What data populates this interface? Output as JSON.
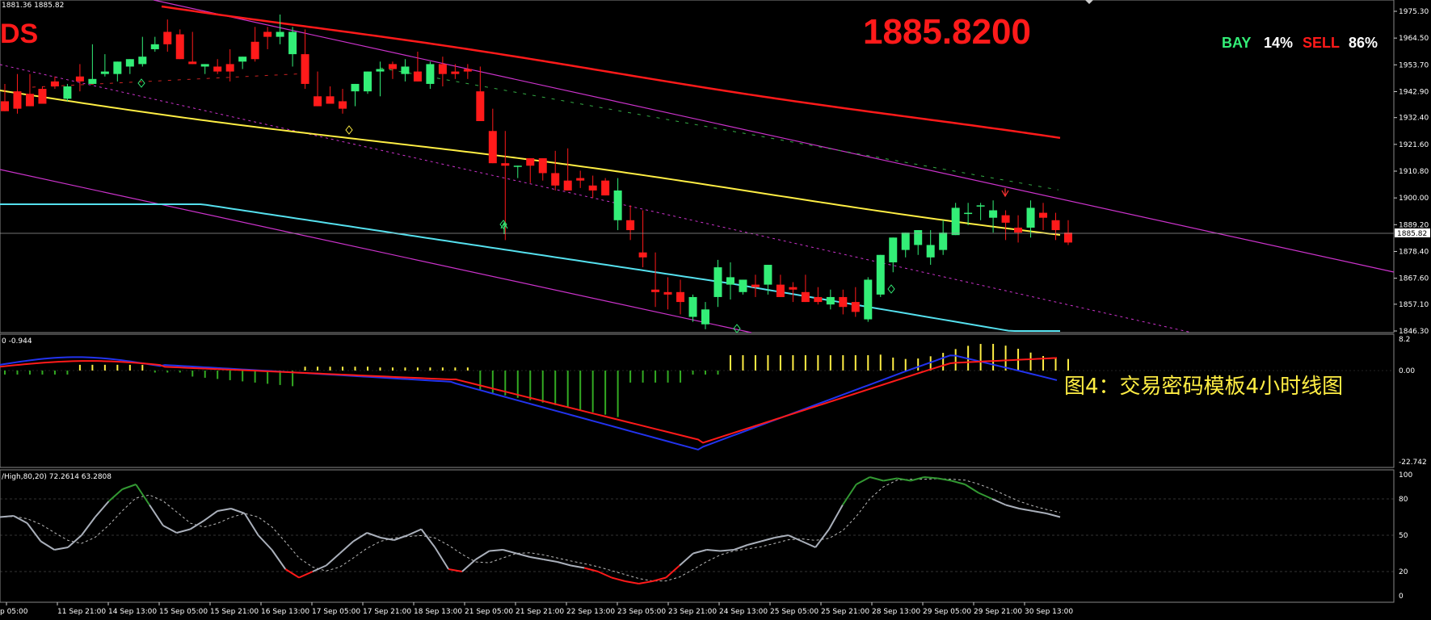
{
  "window": {
    "top_info": "1881.36 1885.82",
    "symbol_fragment": "DS",
    "big_price": "1885.8200",
    "bay_label": "BAY",
    "bay_pct": "14%",
    "sell_label": "SELL",
    "sell_pct": "86%",
    "caption": "图4：交易密码模板4小时线图",
    "current_price_tag": "1885.82"
  },
  "price_axis": [
    "1975.30",
    "1964.50",
    "1953.70",
    "1942.90",
    "1932.40",
    "1921.60",
    "1910.80",
    "1900.00",
    "1889.20",
    "1878.40",
    "1867.60",
    "1857.10",
    "1846.30"
  ],
  "macd": {
    "label": "0 -0.944",
    "axis": [
      "8.2",
      "0.00",
      "-22.742"
    ]
  },
  "stoch": {
    "label": "/High,80,20) 72.2614 63.2808",
    "axis": [
      "100",
      "80",
      "50",
      "20",
      "0"
    ]
  },
  "time_axis": [
    "p 05:00",
    "11 Sep 21:00",
    "14 Sep 13:00",
    "15 Sep 05:00",
    "15 Sep 21:00",
    "16 Sep 13:00",
    "17 Sep 05:00",
    "17 Sep 21:00",
    "18 Sep 13:00",
    "21 Sep 05:00",
    "21 Sep 21:00",
    "22 Sep 13:00",
    "23 Sep 05:00",
    "23 Sep 21:00",
    "24 Sep 13:00",
    "25 Sep 05:00",
    "25 Sep 21:00",
    "28 Sep 13:00",
    "29 Sep 05:00",
    "29 Sep 21:00",
    "30 Sep 13:00"
  ],
  "colors": {
    "bull": "#33ee77",
    "bear": "#ff1a1a",
    "ma_red": "#ff1a1a",
    "ma_yellow": "#ffee44",
    "ma_cyan": "#55e0ee",
    "channel": "#cc33cc",
    "macd_main": "#2233ee",
    "macd_signal": "#ff1a1a"
  },
  "chart_data": {
    "type": "candlestick",
    "candles": [
      [
        1939,
        1946,
        1936,
        1935
      ],
      [
        1943,
        1950,
        1934,
        1936
      ],
      [
        1942,
        1950,
        1938,
        1937
      ],
      [
        1944,
        1945,
        1940,
        1938
      ],
      [
        1947,
        1949,
        1944,
        1945
      ],
      [
        1940,
        1946,
        1939,
        1945
      ],
      [
        1949,
        1954,
        1943,
        1947
      ],
      [
        1946,
        1962,
        1946,
        1948
      ],
      [
        1950,
        1958,
        1949,
        1951
      ],
      [
        1950,
        1955,
        1947,
        1955
      ],
      [
        1953,
        1955,
        1950,
        1956
      ],
      [
        1954,
        1965,
        1953,
        1957
      ],
      [
        1960,
        1965,
        1959,
        1962
      ],
      [
        1967,
        1972,
        1959,
        1962
      ],
      [
        1966,
        1968,
        1964,
        1956
      ],
      [
        1955,
        1967,
        1954,
        1954
      ],
      [
        1953,
        1954,
        1950,
        1954
      ],
      [
        1953,
        1956,
        1950,
        1951
      ],
      [
        1954,
        1960,
        1947,
        1951
      ],
      [
        1955,
        1955,
        1952,
        1957
      ],
      [
        1963,
        1969,
        1955,
        1956
      ],
      [
        1967,
        1969,
        1960,
        1965
      ],
      [
        1965,
        1974,
        1962,
        1967
      ],
      [
        1958,
        1969,
        1953,
        1967
      ],
      [
        1958,
        1968,
        1944,
        1946
      ],
      [
        1941,
        1951,
        1939,
        1937
      ],
      [
        1941,
        1945,
        1938,
        1938
      ],
      [
        1939,
        1944,
        1934,
        1936
      ],
      [
        1943,
        1942,
        1937,
        1946
      ],
      [
        1943,
        1951,
        1942,
        1951
      ],
      [
        1951,
        1955,
        1941,
        1952
      ],
      [
        1954,
        1955,
        1948,
        1952
      ],
      [
        1950,
        1956,
        1947,
        1953
      ],
      [
        1951,
        1959,
        1948,
        1947
      ],
      [
        1946,
        1955,
        1944,
        1954
      ],
      [
        1954,
        1957,
        1945,
        1950
      ],
      [
        1951,
        1954,
        1948,
        1950
      ],
      [
        1952,
        1954,
        1948,
        1951
      ],
      [
        1943,
        1953,
        1936,
        1931
      ],
      [
        1927,
        1936,
        1915,
        1914
      ],
      [
        1914,
        1927,
        1883,
        1913
      ],
      [
        1913,
        1913,
        1908,
        1913
      ],
      [
        1916,
        1916,
        1906,
        1913
      ],
      [
        1916,
        1916,
        1907,
        1910
      ],
      [
        1910,
        1919,
        1903,
        1905
      ],
      [
        1907,
        1920,
        1906,
        1903
      ],
      [
        1908,
        1911,
        1904,
        1907
      ],
      [
        1905,
        1909,
        1900,
        1903
      ],
      [
        1907,
        1908,
        1903,
        1901
      ],
      [
        1891,
        1908,
        1887,
        1903
      ],
      [
        1891,
        1897,
        1883,
        1887
      ],
      [
        1878,
        1895,
        1872,
        1876
      ],
      [
        1863,
        1878,
        1856,
        1862
      ],
      [
        1862,
        1868,
        1855,
        1861
      ],
      [
        1862,
        1867,
        1853,
        1858
      ],
      [
        1852,
        1861,
        1850,
        1860
      ],
      [
        1849,
        1858,
        1847,
        1855
      ],
      [
        1860,
        1875,
        1856,
        1872
      ],
      [
        1865,
        1874,
        1859,
        1868
      ],
      [
        1862,
        1865,
        1861,
        1867
      ],
      [
        1865,
        1869,
        1860,
        1864
      ],
      [
        1865,
        1868,
        1861,
        1873
      ],
      [
        1865,
        1869,
        1862,
        1860
      ],
      [
        1864,
        1866,
        1858,
        1863
      ],
      [
        1862,
        1869,
        1860,
        1858
      ],
      [
        1860,
        1864,
        1857,
        1858
      ],
      [
        1857,
        1863,
        1855,
        1860
      ],
      [
        1860,
        1863,
        1853,
        1856
      ],
      [
        1858,
        1864,
        1852,
        1854
      ],
      [
        1851,
        1868,
        1850,
        1867
      ],
      [
        1861,
        1874,
        1860,
        1877
      ],
      [
        1874,
        1881,
        1870,
        1884
      ],
      [
        1879,
        1884,
        1876,
        1886
      ],
      [
        1881,
        1883,
        1877,
        1887
      ],
      [
        1876,
        1887,
        1873,
        1881
      ],
      [
        1879,
        1891,
        1877,
        1886
      ],
      [
        1885,
        1898,
        1885,
        1896
      ],
      [
        1894,
        1898,
        1889,
        1894
      ],
      [
        1897,
        1898,
        1891,
        1897
      ],
      [
        1892,
        1899,
        1886,
        1895
      ],
      [
        1893,
        1895,
        1883,
        1890
      ],
      [
        1888,
        1893,
        1882,
        1886
      ],
      [
        1888,
        1899,
        1884,
        1896
      ],
      [
        1894,
        1898,
        1887,
        1892
      ],
      [
        1891,
        1894,
        1883,
        1887
      ],
      [
        1886,
        1891,
        1881,
        1882
      ]
    ]
  }
}
